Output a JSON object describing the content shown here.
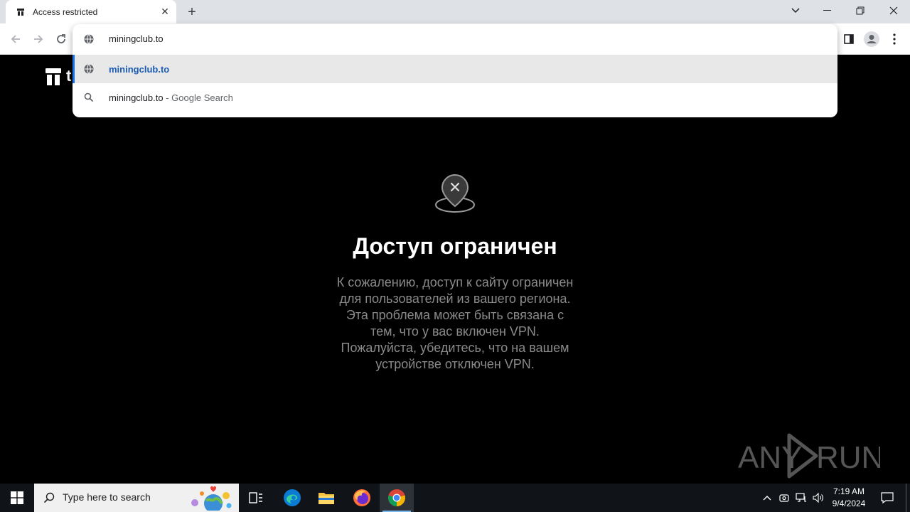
{
  "tab": {
    "title": "Access restricted"
  },
  "omnibox": {
    "input": "miningclub.to",
    "suggestions": [
      {
        "text": "miningclub.to",
        "kind": "url"
      },
      {
        "text": "miningclub.to",
        "suffix": " - Google Search",
        "kind": "search"
      }
    ]
  },
  "page": {
    "logo_letter": "t",
    "heading": "Доступ ограничен",
    "message_lines": [
      "К сожалению, доступ к сайту ограничен",
      "для пользователей из вашего региона.",
      "Эта проблема может быть связана с",
      "тем, что у вас включен VPN.",
      "Пожалуйста, убедитесь, что на вашем",
      "устройстве отключен VPN."
    ]
  },
  "watermark": {
    "text": "ANY RUN"
  },
  "taskbar": {
    "search_placeholder": "Type here to search",
    "time": "7:19 AM",
    "date": "9/4/2024"
  },
  "colors": {
    "accent": "#1a73e8",
    "page_bg": "#000000",
    "taskbar_bg": "#101418"
  }
}
